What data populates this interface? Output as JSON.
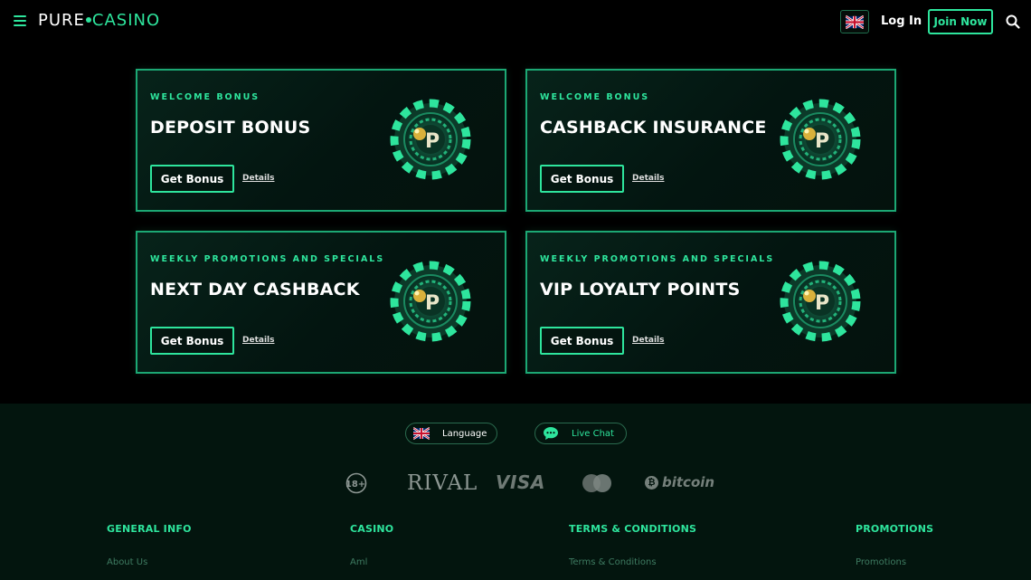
{
  "header": {
    "logo_left": "PURE",
    "logo_right": "CASINO",
    "login_label": "Log In",
    "join_label": "Join Now"
  },
  "cards": [
    {
      "eyebrow": "WELCOME BONUS",
      "title": "DEPOSIT BONUS",
      "button": "Get Bonus",
      "details": "Details"
    },
    {
      "eyebrow": "WELCOME BONUS",
      "title": "CASHBACK INSURANCE",
      "button": "Get Bonus",
      "details": "Details"
    },
    {
      "eyebrow": "WEEKLY PROMOTIONS AND SPECIALS",
      "title": "NEXT DAY CASHBACK",
      "button": "Get Bonus",
      "details": "Details"
    },
    {
      "eyebrow": "WEEKLY PROMOTIONS AND SPECIALS",
      "title": "VIP LOYALTY POINTS",
      "button": "Get Bonus",
      "details": "Details"
    }
  ],
  "footer": {
    "language_label": "Language",
    "live_chat_label": "Live Chat",
    "payments": {
      "age": "18+",
      "rival": "RIVAL",
      "visa": "VISA",
      "bitcoin": "bitcoin"
    },
    "columns": [
      {
        "heading": "GENERAL INFO",
        "link": "About Us"
      },
      {
        "heading": "CASINO",
        "link": "Aml"
      },
      {
        "heading": "TERMS & CONDITIONS",
        "link": "Terms & Conditions"
      },
      {
        "heading": "PROMOTIONS",
        "link": "Promotions"
      }
    ]
  },
  "colors": {
    "accent": "#2ee59d",
    "card_border": "#1ca874",
    "footer_bg": "#03150e"
  }
}
